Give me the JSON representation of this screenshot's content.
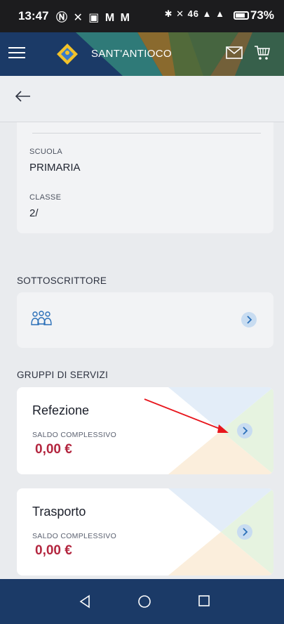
{
  "status_bar": {
    "time": "13:47",
    "left_icons": "Ⓝ ✕ ▣ M M",
    "right_icons": "✱ ✕ 46 ▲ ▲",
    "battery": "73%"
  },
  "app": {
    "title": "SANT'ANTIOCO",
    "brand_color": "#1b3a67",
    "accent_color": "#b3263f"
  },
  "info_card": {
    "school_label": "SCUOLA",
    "school_value": "PRIMARIA",
    "class_label": "CLASSE",
    "class_value": "2/"
  },
  "subscriber": {
    "section_title": "SOTTOSCRITTORE",
    "icon": "people-group-icon"
  },
  "services": {
    "section_title": "GRUPPI DI SERVIZI",
    "items": [
      {
        "name": "Refezione",
        "balance_label": "SALDO COMPLESSIVO",
        "balance_value": "0,00 €"
      },
      {
        "name": "Trasporto",
        "balance_label": "SALDO COMPLESSIVO",
        "balance_value": "0,00 €"
      }
    ]
  },
  "icons": {
    "menu": "hamburger-menu-icon",
    "mail": "mail-icon",
    "cart": "shopping-cart-icon",
    "back": "back-arrow-icon",
    "chevron": "chevron-right-icon",
    "nav_back": "triangle-back-icon",
    "nav_home": "circle-home-icon",
    "nav_recents": "square-recents-icon"
  }
}
